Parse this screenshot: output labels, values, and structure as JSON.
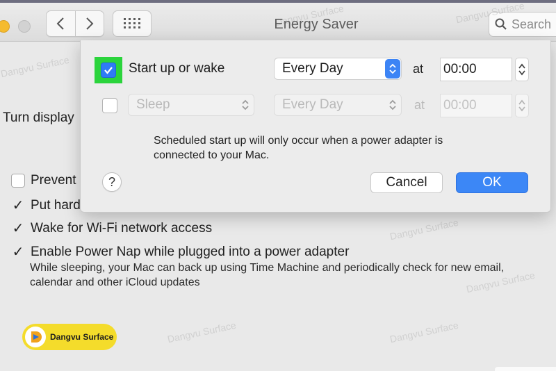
{
  "window": {
    "title": "Energy Saver",
    "search_placeholder": "Search"
  },
  "background": {
    "turn_display": "Turn display",
    "options": [
      {
        "label": "Prevent",
        "checked": false
      },
      {
        "label": "Put hard",
        "checked": true
      },
      {
        "label": "Wake for Wi-Fi network access",
        "checked": true
      },
      {
        "label": "Enable Power Nap while plugged into a power adapter",
        "checked": true
      }
    ],
    "description_line1": "While sleeping, your Mac can back up using Time Machine and periodically check for new email,",
    "description_line2": "calendar and other iCloud updates"
  },
  "schedule": {
    "row1": {
      "checked": true,
      "label": "Start up or wake",
      "frequency": "Every Day",
      "at": "at",
      "time": "00:00"
    },
    "row2": {
      "checked": false,
      "action": "Sleep",
      "frequency": "Every Day",
      "at": "at",
      "time": "00:00"
    },
    "note_line1": "Scheduled start up will only occur when a power adapter is",
    "note_line2": "connected to your Mac.",
    "help": "?",
    "cancel_label": "Cancel",
    "ok_label": "OK"
  },
  "watermark": {
    "text": "Dangvu Surface",
    "brand": "Dangvu Surface"
  },
  "colors": {
    "accent": "#3c87f6",
    "highlight_frame": "#2bd43c",
    "brand_badge": "#f4dc2b"
  }
}
